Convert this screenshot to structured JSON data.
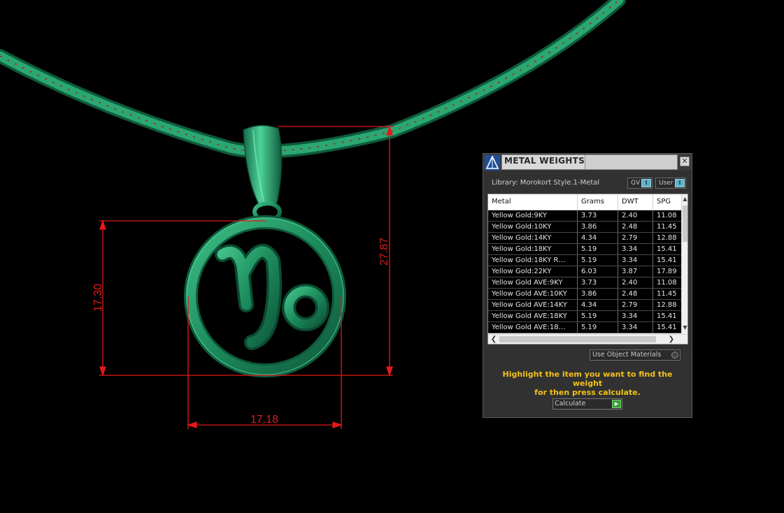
{
  "viewport": {
    "dimensions": {
      "height_mm": "27.87",
      "ring_height_mm": "17.30",
      "ring_width_mm": "17.18"
    },
    "colors": {
      "metal": "#1f8a5e",
      "metal_highlight": "#5fd6a2",
      "chain_inner": "#b01c1c",
      "dimension_line": "#e3191b"
    }
  },
  "panel": {
    "title": "METAL WEIGHTS",
    "logo_icon": "pyramid-logo-icon",
    "close_label": "✕",
    "library_label": "Library: Morokort Style.1-Metal",
    "toggles": [
      {
        "label": "GV",
        "knob": "I"
      },
      {
        "label": "User",
        "knob": "I"
      }
    ],
    "table": {
      "columns": [
        "Metal",
        "Grams",
        "DWT",
        "SPG"
      ],
      "rows": [
        {
          "metal": "Yellow Gold:9KY",
          "grams": "3.73",
          "dwt": "2.40",
          "spg": "11.08"
        },
        {
          "metal": "Yellow Gold:10KY",
          "grams": "3.86",
          "dwt": "2.48",
          "spg": "11.45"
        },
        {
          "metal": "Yellow Gold:14KY",
          "grams": "4.34",
          "dwt": "2.79",
          "spg": "12.88"
        },
        {
          "metal": "Yellow Gold:18KY",
          "grams": "5.19",
          "dwt": "3.34",
          "spg": "15.41"
        },
        {
          "metal": "Yellow Gold:18KY R…",
          "grams": "5.19",
          "dwt": "3.34",
          "spg": "15.41"
        },
        {
          "metal": "Yellow Gold:22KY",
          "grams": "6.03",
          "dwt": "3.87",
          "spg": "17.89"
        },
        {
          "metal": "Yellow Gold AVE:9KY",
          "grams": "3.73",
          "dwt": "2.40",
          "spg": "11.08"
        },
        {
          "metal": "Yellow Gold AVE:10KY",
          "grams": "3.86",
          "dwt": "2.48",
          "spg": "11.45"
        },
        {
          "metal": "Yellow Gold AVE:14KY",
          "grams": "4.34",
          "dwt": "2.79",
          "spg": "12.88"
        },
        {
          "metal": "Yellow Gold AVE:18KY",
          "grams": "5.19",
          "dwt": "3.34",
          "spg": "15.41"
        },
        {
          "metal": "Yellow Gold AVE:18…",
          "grams": "5.19",
          "dwt": "3.34",
          "spg": "15.41"
        }
      ]
    },
    "scroll": {
      "up": "▲",
      "down": "▼",
      "left": "❮",
      "right": "❯"
    },
    "use_object_materials_label": "Use Object Materials",
    "hint_line1": "Highlight the item you want to find the weight",
    "hint_line2": "for then press calculate.",
    "calculate_label": "Calculate",
    "calculate_icon": "play-icon",
    "colors": {
      "panel_bg": "#313131",
      "hint_text": "#f2c118",
      "accent_blue": "#5fb3c9",
      "calculate_green": "#3f9c3a"
    }
  }
}
